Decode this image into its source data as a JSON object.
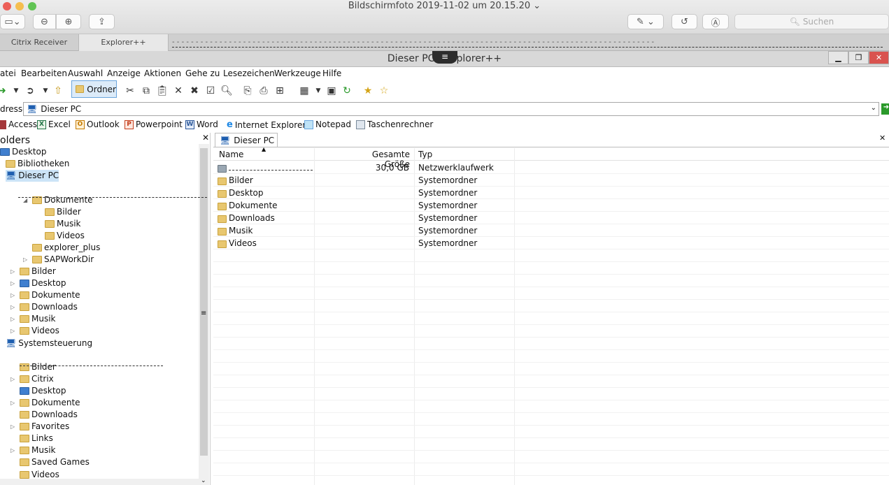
{
  "mac": {
    "title": "Bildschirmfoto 2019-11-02 um 20.15.20",
    "search_placeholder": "Suchen"
  },
  "tabs": [
    {
      "label": "Citrix Receiver"
    },
    {
      "label": "Explorer++"
    }
  ],
  "window": {
    "title": "Dieser PC - Explorer++"
  },
  "menu": [
    "atei",
    "Bearbeiten",
    "Auswahl",
    "Anzeige",
    "Aktionen",
    "Gehe zu",
    "Lesezeichen",
    "Werkzeuge",
    "Hilfe"
  ],
  "toolbar": {
    "folders_label": "Ordner"
  },
  "address": {
    "label": "dresse",
    "value": "Dieser PC"
  },
  "bookmarks": [
    {
      "label": "Access",
      "icon": "access-icon"
    },
    {
      "label": "Excel",
      "icon": "excel-icon"
    },
    {
      "label": "Outlook",
      "icon": "outlook-icon"
    },
    {
      "label": "Powerpoint",
      "icon": "powerpoint-icon"
    },
    {
      "label": "Word",
      "icon": "word-icon"
    },
    {
      "label": "Internet Explorer",
      "icon": "internet-explorer-icon"
    },
    {
      "label": "Notepad",
      "icon": "notepad-icon"
    },
    {
      "label": "Taschenrechner",
      "icon": "calculator-icon"
    }
  ],
  "folders": {
    "header": "olders",
    "items": [
      {
        "label": "Desktop"
      },
      {
        "label": "Bibliotheken"
      },
      {
        "label": "Dieser PC"
      },
      {
        "label": "Dokumente"
      },
      {
        "label": "Bilder"
      },
      {
        "label": "Musik"
      },
      {
        "label": "Videos"
      },
      {
        "label": "explorer_plus"
      },
      {
        "label": "SAPWorkDir"
      },
      {
        "label": "Bilder"
      },
      {
        "label": "Desktop"
      },
      {
        "label": "Dokumente"
      },
      {
        "label": "Downloads"
      },
      {
        "label": "Musik"
      },
      {
        "label": "Videos"
      },
      {
        "label": "Systemsteuerung"
      },
      {
        "label": "Bilder"
      },
      {
        "label": "Citrix"
      },
      {
        "label": "Desktop"
      },
      {
        "label": "Dokumente"
      },
      {
        "label": "Downloads"
      },
      {
        "label": "Favorites"
      },
      {
        "label": "Links"
      },
      {
        "label": "Musik"
      },
      {
        "label": "Saved Games"
      },
      {
        "label": "Videos"
      }
    ]
  },
  "tab_pane": {
    "label": "Dieser PC"
  },
  "columns": {
    "name": "Name",
    "size": "Gesamte Größe",
    "type": "Typ"
  },
  "files": [
    {
      "name": "",
      "size": "30,0 GB",
      "type": "Netzwerklaufwerk"
    },
    {
      "name": "Bilder",
      "size": "",
      "type": "Systemordner"
    },
    {
      "name": "Desktop",
      "size": "",
      "type": "Systemordner"
    },
    {
      "name": "Dokumente",
      "size": "",
      "type": "Systemordner"
    },
    {
      "name": "Downloads",
      "size": "",
      "type": "Systemordner"
    },
    {
      "name": "Musik",
      "size": "",
      "type": "Systemordner"
    },
    {
      "name": "Videos",
      "size": "",
      "type": "Systemordner"
    }
  ]
}
